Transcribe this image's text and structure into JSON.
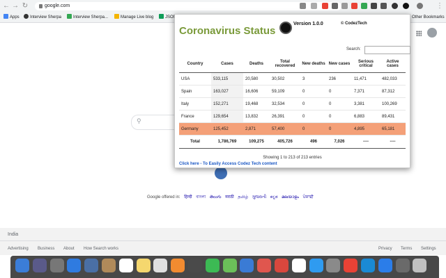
{
  "browser": {
    "url": "google.com",
    "bookmarks": [
      {
        "label": "Apps",
        "color": "#4285f4"
      },
      {
        "label": "Interview Sherpa",
        "color": "#333333"
      },
      {
        "label": "Interview Sherpa...",
        "color": "#34a853"
      },
      {
        "label": "Manage Live blog",
        "color": "#f4b400"
      },
      {
        "label": "JSON",
        "color": "#0f9d58"
      }
    ],
    "other_bookmarks": "Other Bookmarks"
  },
  "popup": {
    "title": "Coronavirus Status",
    "version": "Version 1.0.0",
    "copyright": "© CodezTech",
    "search_label": "Search:",
    "search_value": "",
    "headers": [
      "Country",
      "Cases",
      "Deaths",
      "Total recovered",
      "New deaths",
      "New cases",
      "Serious critical",
      "Active cases"
    ],
    "rows": [
      {
        "country": "USA",
        "cases": "533,115",
        "deaths": "20,580",
        "recovered": "30,502",
        "new_deaths": "3",
        "new_cases": "236",
        "critical": "11,471",
        "active": "482,033"
      },
      {
        "country": "Spain",
        "cases": "163,027",
        "deaths": "16,606",
        "recovered": "59,109",
        "new_deaths": "0",
        "new_cases": "0",
        "critical": "7,371",
        "active": "87,312"
      },
      {
        "country": "Italy",
        "cases": "152,271",
        "deaths": "19,468",
        "recovered": "32,534",
        "new_deaths": "0",
        "new_cases": "0",
        "critical": "3,381",
        "active": "100,269"
      },
      {
        "country": "France",
        "cases": "129,654",
        "deaths": "13,832",
        "recovered": "26,391",
        "new_deaths": "0",
        "new_cases": "0",
        "critical": "6,883",
        "active": "89,431"
      },
      {
        "country": "Germany",
        "cases": "125,452",
        "deaths": "2,871",
        "recovered": "57,400",
        "new_deaths": "0",
        "new_cases": "0",
        "critical": "4,895",
        "active": "65,181"
      }
    ],
    "total": {
      "label": "Total",
      "cases": "1,786,769",
      "deaths": "109,275",
      "recovered": "405,726",
      "new_deaths": "496",
      "new_cases": "7,026",
      "critical": "----",
      "active": "----"
    },
    "info": "Showing 1 to 213 of 213 entries",
    "link": "Click here - To Easily Access Codez Tech content"
  },
  "google": {
    "offered_label": "Google offered in:",
    "languages": [
      "हिन्दी",
      "বাংলা",
      "తెలుగు",
      "मराठी",
      "தமிழ்",
      "ગુજરાતી",
      "ಕನ್ನಡ",
      "മലയാളം",
      "ਪੰਜਾਬੀ"
    ],
    "country": "India",
    "footer_left": [
      "Advertising",
      "Business",
      "About",
      "How Search works"
    ],
    "footer_right": [
      "Privacy",
      "Terms",
      "Settings"
    ]
  },
  "dock": {
    "icon_colors": [
      "#3b7dd8",
      "#5a5a8a",
      "#777777",
      "#2f7be0",
      "#4a6fa5",
      "#b08a5a",
      "#ffffff",
      "#f5d76e",
      "#e0e0e0",
      "#f28b30",
      "#4a4a4a",
      "#3cba54",
      "#6bbf59",
      "#3a7bd5",
      "#e0564e",
      "#d9473d",
      "#ffffff",
      "#2f9bf0",
      "#8a8a8a",
      "#e94235",
      "#1a8ad5",
      "#2b7de9",
      "#6a6a6a",
      "#c0c0c0"
    ]
  }
}
